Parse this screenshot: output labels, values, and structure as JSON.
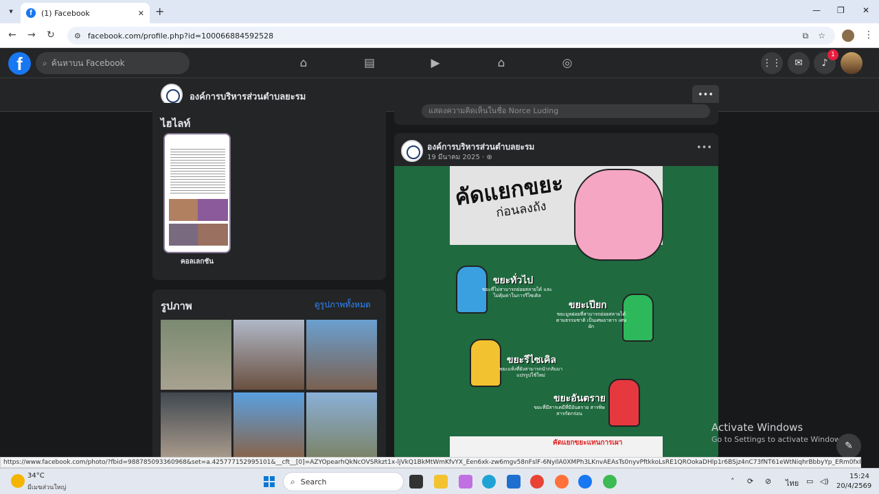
{
  "browser": {
    "tab_title": "(1) Facebook",
    "url": "facebook.com/profile.php?id=100066884592528"
  },
  "fb": {
    "search_placeholder": "ค้นหาบน Facebook",
    "notification_count": "1"
  },
  "profile": {
    "name": "องค์การบริหารส่วนตำบลยะรม"
  },
  "highlights": {
    "title": "ไฮไลท์",
    "item_label": "คอลเลกชัน"
  },
  "photos": {
    "title": "รูปภาพ",
    "see_all": "ดูรูปภาพทั้งหมด"
  },
  "prev_post": {
    "comment_prompt": "แสดงความคิดเห็นในชื่อ Norce Luding"
  },
  "post": {
    "author": "องค์การบริหารส่วนตำบลยะรม",
    "date": "19 มีนาคม 2025 · ",
    "image": {
      "title_main": "คัดแยกขยะ",
      "title_sub": "ก่อนลงถัง",
      "bins": [
        {
          "label": "ขยะทั่วไป",
          "desc": "ขยะที่ไม่สามารถย่อยสลายได้ และไม่คุ้มค่าในการรีไซเคิล",
          "color": "#3aa0e0"
        },
        {
          "label": "ขยะเปียก",
          "desc": "ขยะมูลฝอยที่สามารถย่อยสลายได้ตามธรรมชาติ เป็นเศษอาหาร เศษผัก",
          "color": "#2eb85c"
        },
        {
          "label": "ขยะรีไซเคิล",
          "desc": "ขยะแห้งที่ยังสามารถนำกลับมาแปรรูปใช้ใหม่",
          "color": "#f2c230"
        },
        {
          "label": "ขยะอันตราย",
          "desc": "ขยะที่มีสารเคมีที่มีอันตราย สารพิษ สารกัดกร่อน",
          "color": "#e5393f"
        }
      ],
      "bottom_text": "คัดแยกขยะแทนการเผา"
    }
  },
  "watermark": {
    "line1": "Activate Windows",
    "line2": "Go to Settings to activate Windows."
  },
  "status_url": "https://www.facebook.com/photo/?fbid=988785093360968&set=a.425777152995101&__cft__[0]=AZYOpearhQkNcOVSRkzt1x-ljVkQ1BkMtWmKfvYX_Een6xk-zw6mgv58nFslF-6NyIlA0XMPh3LKnvAEAsTs0nyvPftkkoLsRE1QROokaDHlp1r6BSjz4nC73fNT61eWtNiqhrBbbyYp_ERm0fxFgo7o4vw8_2gb...",
  "taskbar": {
    "temperature": "34°C",
    "weather": "มีเมฆส่วนใหญ่",
    "search_label": "Search",
    "language": "ไทย",
    "time": "15:24",
    "date": "20/4/2569"
  }
}
